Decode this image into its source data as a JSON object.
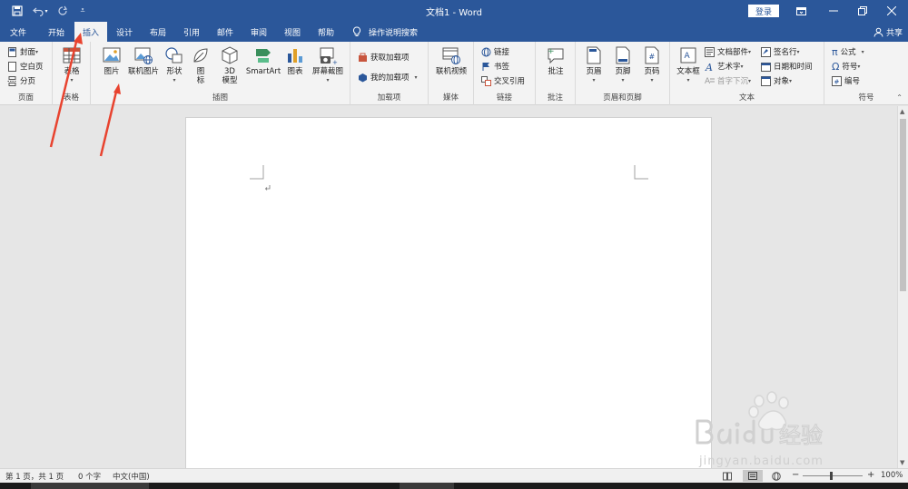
{
  "titlebar": {
    "doc_title": "文档1  -  Word",
    "login_label": "登录"
  },
  "tabs": [
    {
      "label": "文件"
    },
    {
      "label": "开始"
    },
    {
      "label": "插入"
    },
    {
      "label": "设计"
    },
    {
      "label": "布局"
    },
    {
      "label": "引用"
    },
    {
      "label": "邮件"
    },
    {
      "label": "审阅"
    },
    {
      "label": "视图"
    },
    {
      "label": "帮助"
    }
  ],
  "tell_me": "操作说明搜索",
  "share_label": "共享",
  "ribbon": {
    "pages": {
      "label": "页面",
      "cover": "封面",
      "blank": "空白页",
      "break": "分页"
    },
    "tables": {
      "label": "表格",
      "table": "表格"
    },
    "illustrations": {
      "label": "插图",
      "picture": "图片",
      "online_picture": "联机图片",
      "shapes": "形状",
      "icons_l1": "图",
      "icons_l2": "标",
      "model_l1": "3D",
      "model_l2": "模型",
      "smartart": "SmartArt",
      "chart": "图表",
      "screenshot": "屏幕截图"
    },
    "addins": {
      "label": "加载项",
      "get": "获取加载项",
      "mine": "我的加载项"
    },
    "media": {
      "label": "媒体",
      "online_video": "联机视频"
    },
    "links": {
      "label": "链接",
      "link": "链接",
      "bookmark": "书签",
      "cross_ref": "交叉引用"
    },
    "comments": {
      "label": "批注",
      "comment": "批注"
    },
    "header_footer": {
      "label": "页眉和页脚",
      "header": "页眉",
      "footer": "页脚",
      "page_number": "页码"
    },
    "text": {
      "label": "文本",
      "textbox": "文本框",
      "quick_parts": "文档部件",
      "wordart": "艺术字",
      "drop_cap": "首字下沉",
      "signature": "签名行",
      "datetime": "日期和时间",
      "object": "对象"
    },
    "symbols": {
      "label": "符号",
      "equation": "公式",
      "symbol": "符号",
      "number": "编号"
    }
  },
  "status": {
    "page": "第 1 页，共 1 页",
    "words": "0 个字",
    "language": "中文(中国)",
    "zoom": "100%"
  },
  "colors": {
    "brand": "#2b579a",
    "annotation": "#e8432f"
  },
  "watermark": {
    "brand": "Baidu经验",
    "url": "jingyan.baidu.com"
  }
}
